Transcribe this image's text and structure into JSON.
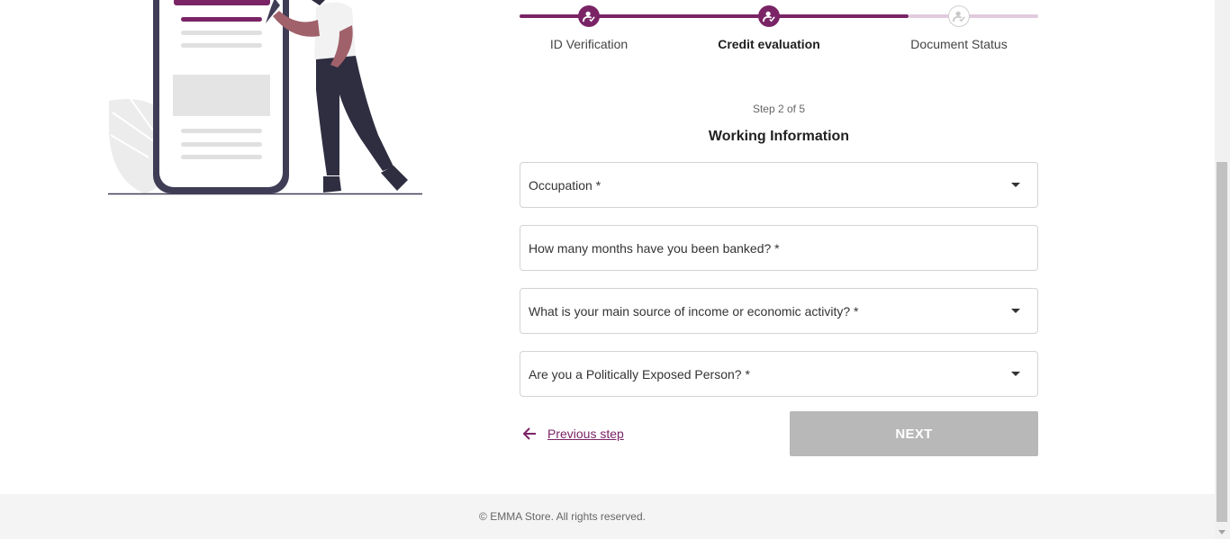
{
  "stepper": {
    "steps": [
      {
        "label": "ID Verification",
        "state": "completed"
      },
      {
        "label": "Credit evaluation",
        "state": "current"
      },
      {
        "label": "Document Status",
        "state": "pending"
      }
    ]
  },
  "form": {
    "step_indicator": "Step 2 of 5",
    "title": "Working Information",
    "fields": [
      {
        "label": "Occupation *",
        "type": "select"
      },
      {
        "label": "How many months have you been banked? *",
        "type": "text"
      },
      {
        "label": "What is your main source of income or economic activity? *",
        "type": "select"
      },
      {
        "label": "Are you a Politically Exposed Person? *",
        "type": "select"
      }
    ],
    "previous_label": "Previous step",
    "next_label": "NEXT"
  },
  "footer": {
    "copyright": "© EMMA Store. All rights reserved."
  },
  "colors": {
    "brand": "#7a2466",
    "brand_light": "#e2cade",
    "disabled_button": "#b8b8b8",
    "footer_bg": "#f4f4f4"
  }
}
